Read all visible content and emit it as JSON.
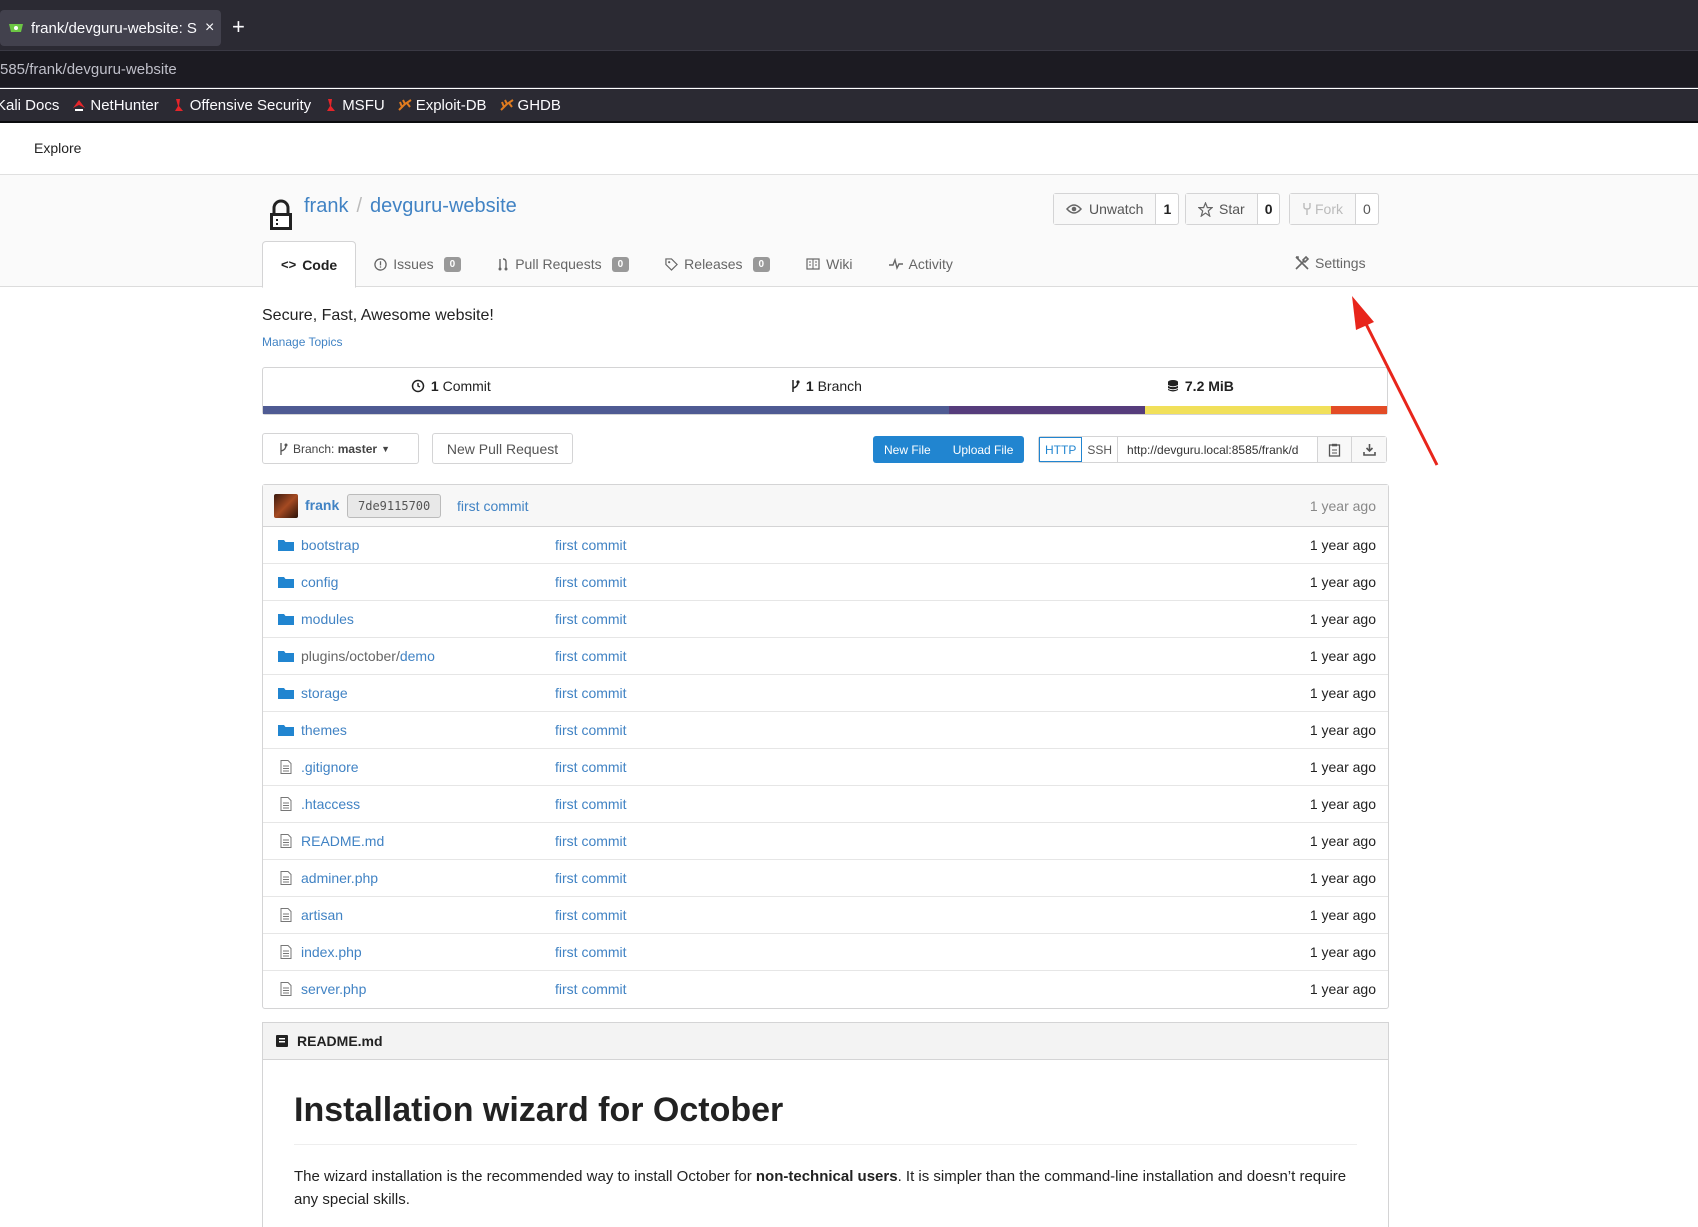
{
  "browser": {
    "tab_title": "frank/devguru-website: S",
    "new_tab": "+",
    "tab_close": "×",
    "url": "585/frank/devguru-website",
    "bookmarks": [
      {
        "label": "Kali Docs",
        "icon": "kali-icon",
        "color": "#8ab4f8"
      },
      {
        "label": "NetHunter",
        "icon": "nethunter-icon",
        "color": "#e5252a"
      },
      {
        "label": "Offensive Security",
        "icon": "offsec-icon",
        "color": "#e5252a"
      },
      {
        "label": "MSFU",
        "icon": "offsec-icon",
        "color": "#e5252a"
      },
      {
        "label": "Exploit-DB",
        "icon": "exploitdb-icon",
        "color": "#e07b1f"
      },
      {
        "label": "GHDB",
        "icon": "exploitdb-icon",
        "color": "#e07b1f"
      }
    ]
  },
  "header": {
    "explore": "Explore"
  },
  "repo": {
    "owner": "frank",
    "separator": "/",
    "name": "devguru-website",
    "watch_label": "Unwatch",
    "watch_count": "1",
    "star_label": "Star",
    "star_count": "0",
    "fork_label": "Fork",
    "fork_count": "0"
  },
  "tabs": {
    "code": "Code",
    "issues": "Issues",
    "issues_count": "0",
    "pulls": "Pull Requests",
    "pulls_count": "0",
    "releases": "Releases",
    "releases_count": "0",
    "wiki": "Wiki",
    "activity": "Activity",
    "settings": "Settings"
  },
  "description": "Secure, Fast, Awesome website!",
  "manage_topics": "Manage Topics",
  "stats": {
    "commits_num": "1",
    "commits_label": "Commit",
    "branches_num": "1",
    "branches_label": "Branch",
    "size": "7.2 MiB"
  },
  "language_bar": [
    {
      "color": "#4f5b93",
      "fraction": 0.61
    },
    {
      "color": "#563d7c",
      "fraction": 0.175
    },
    {
      "color": "#f1e05a",
      "fraction": 0.165
    },
    {
      "color": "#e34c26",
      "fraction": 0.05
    }
  ],
  "toolbar": {
    "branch_prefix": "Branch:",
    "branch_name": "master",
    "new_pr": "New Pull Request",
    "new_file": "New File",
    "upload_file": "Upload File",
    "http": "HTTP",
    "ssh": "SSH",
    "clone_url": "http://devguru.local:8585/frank/d"
  },
  "latest_commit": {
    "user": "frank",
    "sha": "7de9115700",
    "message": "first commit",
    "time": "1 year ago"
  },
  "files": [
    {
      "name": "bootstrap",
      "type": "dir",
      "message": "first commit",
      "time": "1 year ago"
    },
    {
      "name": "config",
      "type": "dir",
      "message": "first commit",
      "time": "1 year ago"
    },
    {
      "name": "modules",
      "type": "dir",
      "message": "first commit",
      "time": "1 year ago"
    },
    {
      "name_prefix": "plugins/october/",
      "name": "demo",
      "type": "dir",
      "message": "first commit",
      "time": "1 year ago"
    },
    {
      "name": "storage",
      "type": "dir",
      "message": "first commit",
      "time": "1 year ago"
    },
    {
      "name": "themes",
      "type": "dir",
      "message": "first commit",
      "time": "1 year ago"
    },
    {
      "name": ".gitignore",
      "type": "file",
      "message": "first commit",
      "time": "1 year ago"
    },
    {
      "name": ".htaccess",
      "type": "file",
      "message": "first commit",
      "time": "1 year ago"
    },
    {
      "name": "README.md",
      "type": "file",
      "message": "first commit",
      "time": "1 year ago"
    },
    {
      "name": "adminer.php",
      "type": "file",
      "message": "first commit",
      "time": "1 year ago"
    },
    {
      "name": "artisan",
      "type": "file",
      "message": "first commit",
      "time": "1 year ago"
    },
    {
      "name": "index.php",
      "type": "file",
      "message": "first commit",
      "time": "1 year ago"
    },
    {
      "name": "server.php",
      "type": "file",
      "message": "first commit",
      "time": "1 year ago"
    }
  ],
  "readme": {
    "filename": "README.md",
    "heading": "Installation wizard for October",
    "para_before": "The wizard installation is the recommended way to install October for ",
    "para_bold": "non-technical users",
    "para_after": ". It is simpler than the command-line installation and doesn’t require any special skills."
  },
  "colors": {
    "link": "#4183c4",
    "primary_button": "#2185d0",
    "annotation_arrow": "#e8251b"
  }
}
